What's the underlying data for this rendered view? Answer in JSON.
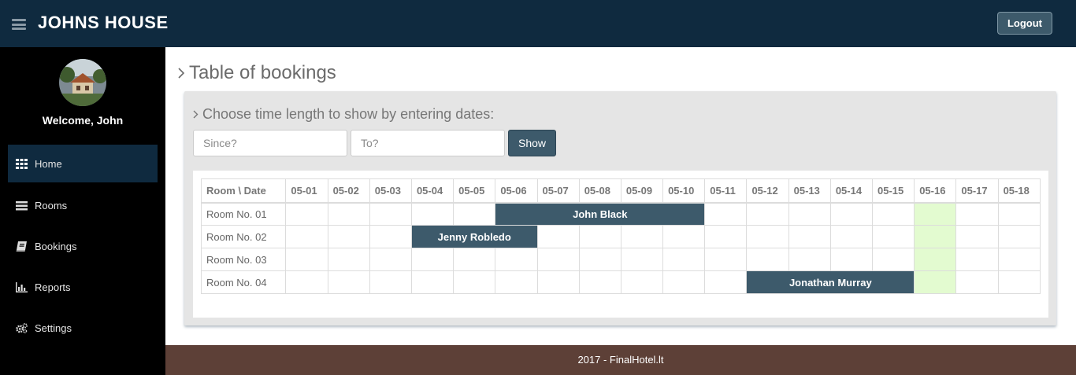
{
  "header": {
    "app_title": "JOHNS HOUSE",
    "logout_label": "Logout"
  },
  "sidebar": {
    "welcome": "Welcome, John",
    "items": [
      {
        "label": "Home",
        "icon": "grid-icon",
        "active": true
      },
      {
        "label": "Rooms",
        "icon": "list-icon",
        "active": false
      },
      {
        "label": "Bookings",
        "icon": "book-icon",
        "active": false
      },
      {
        "label": "Reports",
        "icon": "bar-chart-icon",
        "active": false
      },
      {
        "label": "Settings",
        "icon": "gears-icon",
        "active": false
      }
    ]
  },
  "main": {
    "title": "Table of bookings",
    "filter_heading": "Choose time length to show by entering dates:",
    "since_placeholder": "Since?",
    "to_placeholder": "To?",
    "show_label": "Show"
  },
  "bookings_table": {
    "corner_header": "Room \\ Date",
    "dates": [
      "05-01",
      "05-02",
      "05-03",
      "05-04",
      "05-05",
      "05-06",
      "05-07",
      "05-08",
      "05-09",
      "05-10",
      "05-11",
      "05-12",
      "05-13",
      "05-14",
      "05-15",
      "05-16",
      "05-17",
      "05-18"
    ],
    "highlight_date": "05-16",
    "rooms": [
      {
        "name": "Room No. 01",
        "bookings": [
          {
            "guest": "John Black",
            "start": "05-06",
            "end": "05-10"
          }
        ]
      },
      {
        "name": "Room No. 02",
        "bookings": [
          {
            "guest": "Jenny Robledo",
            "start": "05-04",
            "end": "05-06"
          }
        ]
      },
      {
        "name": "Room No. 03",
        "bookings": []
      },
      {
        "name": "Room No. 04",
        "bookings": [
          {
            "guest": "Jonathan Murray",
            "start": "05-12",
            "end": "05-15"
          }
        ]
      }
    ]
  },
  "footer": {
    "text": "2017 - FinalHotel.lt"
  },
  "colors": {
    "topbar": "#0f2a3f",
    "booking": "#3d5a6b",
    "today_highlight": "#e3fbd0",
    "footer": "#5d4037"
  }
}
